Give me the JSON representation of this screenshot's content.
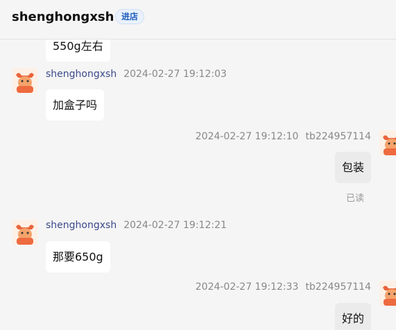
{
  "header": {
    "shop_name": "shenghongxsh",
    "enter_label": "进店"
  },
  "messages": [
    {
      "text": "550g左右"
    },
    {
      "sender": "shenghongxsh",
      "time": "2024-02-27 19:12:03",
      "text": "加盒子吗"
    },
    {
      "sender": "tb224957114",
      "time": "2024-02-27 19:12:10",
      "text": "包装",
      "status": "已读"
    },
    {
      "sender": "shenghongxsh",
      "time": "2024-02-27 19:12:21",
      "text": "那要650g"
    },
    {
      "sender": "tb224957114",
      "time": "2024-02-27 19:12:33",
      "text": "好的"
    }
  ],
  "colors": {
    "link_name": "#3b4a8a",
    "enter_btn": "#1f5fbf"
  }
}
